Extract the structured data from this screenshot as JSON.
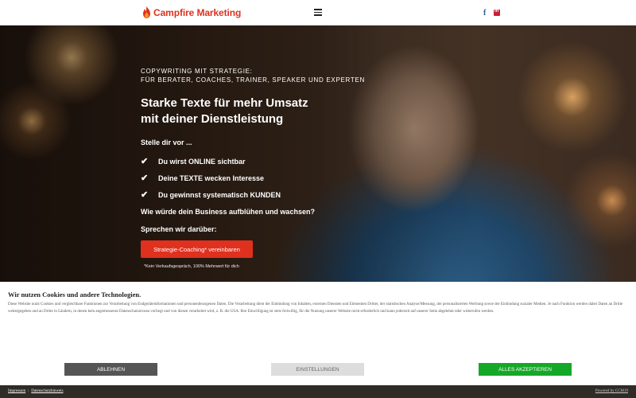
{
  "header": {
    "brand": "Campfire Marketing",
    "menu_icon": "hamburger-icon",
    "social": [
      {
        "name": "facebook",
        "label": "f"
      },
      {
        "name": "linkedin",
        "label": "in"
      }
    ]
  },
  "hero": {
    "eyebrow_line1": "COPYWRITING MIT STRATEGIE:",
    "eyebrow_line2": "FÜR BERATER, COACHES, TRAINER, SPEAKER UND EXPERTEN",
    "headline_line1": "Starke Texte für mehr Umsatz",
    "headline_line2": "mit deiner Dienstleistung",
    "intro": "Stelle dir vor ...",
    "checks": [
      "Du wirst ONLINE sichtbar",
      "Deine TEXTE wecken Interesse",
      "Du gewinnst systematisch KUNDEN"
    ],
    "question": "Wie würde dein Business aufblühen und wachsen?",
    "cta_intro": "Sprechen wir darüber:",
    "cta_label": "Strategie-Coaching* vereinbaren",
    "footnote": "*Kein Verkaufsgespräch, 100% Mehrwert für dich"
  },
  "cookie": {
    "title": "Wir nutzen Cookies und andere Technologien.",
    "text": "Diese Website nutzt Cookies und vergleichbare Funktionen zur Verarbeitung von Endgeräteinformationen und personenbezogenen Daten. Die Verarbeitung dient der Einbindung von Inhalten, externen Diensten und Elementen Dritter, der statistischen Analyse/Messung, der personalisierten Werbung sowie der Einbindung sozialer Medien. Je nach Funktion werden dabei Daten an Dritte weitergegeben und an Dritte in Ländern, in denen kein angemessenes Datenschutzniveau vorliegt und von diesen verarbeitet wird, z. B. die USA. Ihre Einwilligung ist stets freiwillig, für die Nutzung unserer Website nicht erforderlich und kann jederzeit auf unserer Seite abgelehnt oder widerrufen werden.",
    "decline_label": "ABLEHNEN",
    "settings_label": "EINSTELLUNGEN",
    "accept_label": "ALLES AKZEPTIEREN"
  },
  "footer": {
    "imprint": "Impressum",
    "separator": "|",
    "privacy": "Datenschutzhinweis",
    "powered": "Powered by CCM19"
  },
  "colors": {
    "accent": "#e0301e",
    "accept": "#15a827",
    "decline": "#555555"
  }
}
